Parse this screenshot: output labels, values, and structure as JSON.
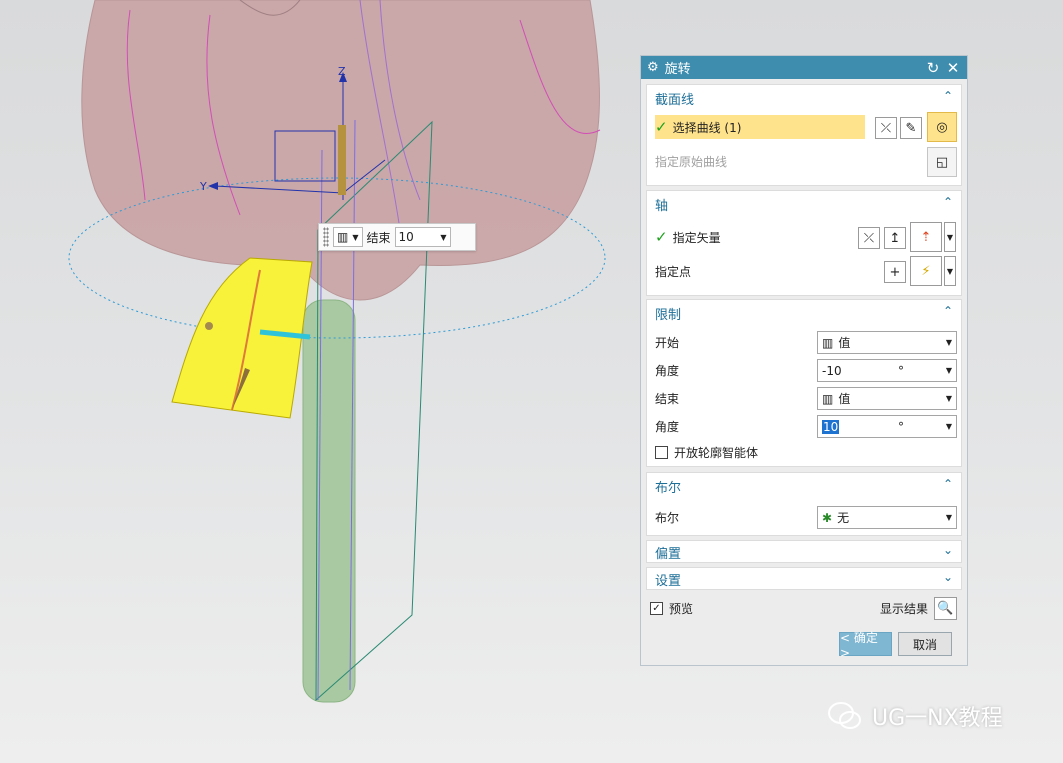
{
  "viewport": {
    "axis_z": "Z",
    "axis_y": "Y"
  },
  "osi": {
    "end_label": "结束",
    "end_value": "10"
  },
  "dialog": {
    "title": "旋转",
    "section": {
      "label": "截面线",
      "select_curve": "选择曲线 (1)",
      "origin_curve": "指定原始曲线"
    },
    "axis": {
      "label": "轴",
      "vector": "指定矢量",
      "point": "指定点"
    },
    "limits": {
      "label": "限制",
      "start_label": "开始",
      "start_mode": "值",
      "start_angle_label": "角度",
      "start_angle": "-10",
      "end_label": "结束",
      "end_mode": "值",
      "end_angle_label": "角度",
      "end_angle": "10",
      "unit": "°",
      "open_profile": "开放轮廓智能体"
    },
    "boolean": {
      "label": "布尔",
      "row_label": "布尔",
      "value": "无"
    },
    "offset": {
      "label": "偏置"
    },
    "settings": {
      "label": "设置"
    },
    "preview": "预览",
    "show_result": "显示结果",
    "ok": "< 确定 >",
    "cancel": "取消"
  },
  "watermark": "UG一NX教程"
}
